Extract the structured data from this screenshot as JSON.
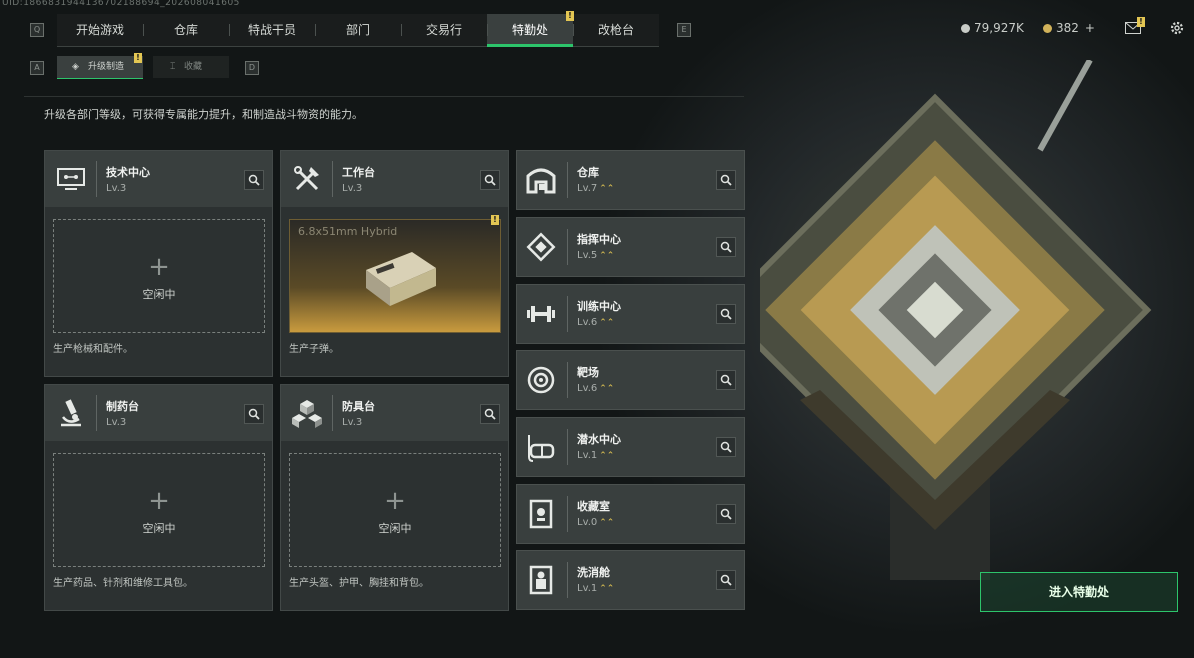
{
  "uid": "UID:1866831944136702188694_202608041605",
  "nav": {
    "tabs": [
      {
        "label": "开始游戏"
      },
      {
        "label": "仓库"
      },
      {
        "label": "特战干员"
      },
      {
        "label": "部门"
      },
      {
        "label": "交易行"
      },
      {
        "label": "特勤处",
        "active": true
      },
      {
        "label": "改枪台"
      }
    ],
    "key_left": "Q",
    "key_right": "E",
    "currency": {
      "silver": "79,927K",
      "gold": "382",
      "gold_plus": "+"
    },
    "badge": "!"
  },
  "subtabs": [
    {
      "label": "升级制造",
      "active": true,
      "key": "A"
    },
    {
      "label": "收藏",
      "active": false,
      "key": "D"
    }
  ],
  "description": "升级各部门等级，可获得专属能力提升，和制造战斗物资的能力。",
  "left_cards": [
    {
      "name": "技术中心",
      "level": "Lv.3",
      "slot": "空闲中",
      "footer": "生产枪械和配件。",
      "icon": "computer-icon"
    },
    {
      "name": "工作台",
      "level": "Lv.3",
      "slot_item": "6.8x51mm Hybrid",
      "footer": "生产子弹。",
      "icon": "tools-icon"
    },
    {
      "name": "制药台",
      "level": "Lv.3",
      "slot": "空闲中",
      "footer": "生产药品、针剂和维修工具包。",
      "icon": "microscope-icon"
    },
    {
      "name": "防具台",
      "level": "Lv.3",
      "slot": "空闲中",
      "footer": "生产头盔、护甲、胸挂和背包。",
      "icon": "cubes-icon"
    }
  ],
  "right_cards": [
    {
      "name": "仓库",
      "level": "Lv.7",
      "icon": "warehouse-icon"
    },
    {
      "name": "指挥中心",
      "level": "Lv.5",
      "icon": "command-icon"
    },
    {
      "name": "训练中心",
      "level": "Lv.6",
      "icon": "dumbbell-icon"
    },
    {
      "name": "靶场",
      "level": "Lv.6",
      "icon": "target-icon"
    },
    {
      "name": "潜水中心",
      "level": "Lv.1",
      "icon": "diving-mask-icon"
    },
    {
      "name": "收藏室",
      "level": "Lv.0",
      "icon": "trophy-case-icon"
    },
    {
      "name": "洗消舱",
      "level": "Lv.1",
      "icon": "hazmat-icon"
    }
  ],
  "enter_button": "进入特勤处",
  "colors": {
    "accent": "#2dc46b",
    "badge": "#e3c653"
  }
}
